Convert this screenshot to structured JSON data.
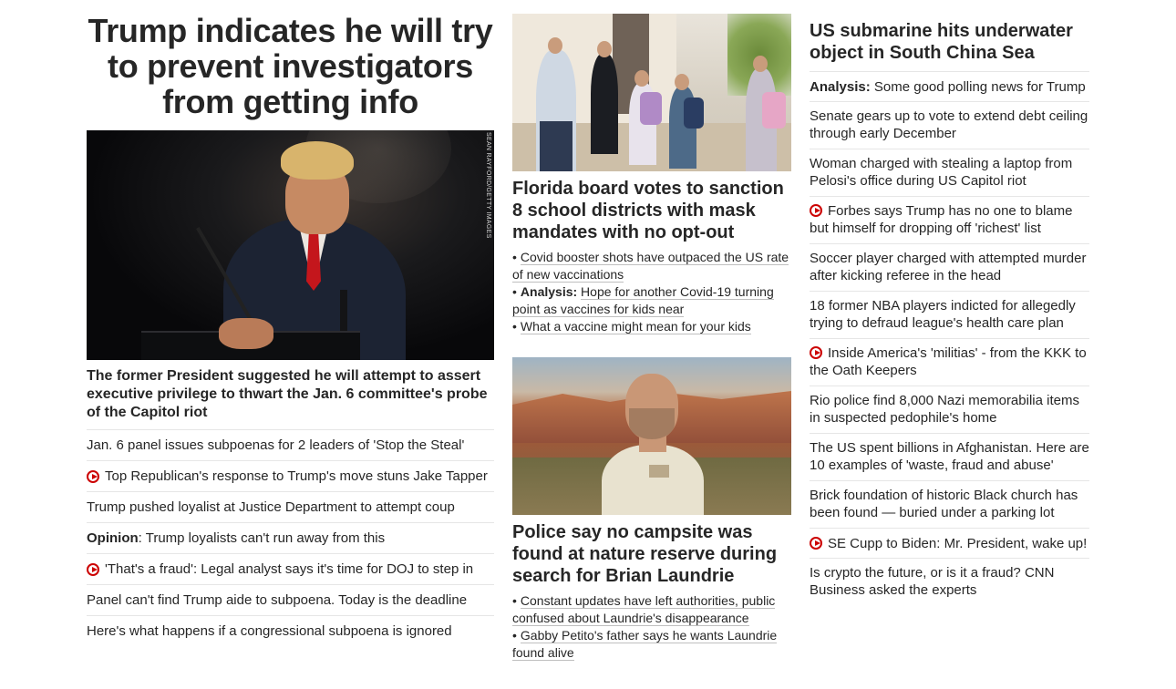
{
  "col1": {
    "headline": "Trump indicates he will try to prevent investigators from getting info",
    "photo_credit": "SEAN RAYFORD/GETTY IMAGES",
    "summary": "The former President suggested he will attempt to assert executive privilege to thwart the Jan. 6 committee's probe of the Capitol riot",
    "items": [
      {
        "prefix": "",
        "text": "Jan. 6 panel issues subpoenas for 2 leaders of 'Stop the Steal'",
        "video": false
      },
      {
        "prefix": "",
        "text": "Top Republican's response to Trump's move stuns Jake Tapper",
        "video": true
      },
      {
        "prefix": "",
        "text": "Trump pushed loyalist at Justice Department to attempt coup",
        "video": false
      },
      {
        "prefix": "Opinion",
        "text": ": Trump loyalists can't run away from this",
        "video": false
      },
      {
        "prefix": "",
        "text": "'That's a fraud': Legal analyst says it's time for DOJ to step in",
        "video": true
      },
      {
        "prefix": "",
        "text": "Panel can't find Trump aide to subpoena. Today is the deadline",
        "video": false
      },
      {
        "prefix": "",
        "text": "Here's what happens if a congressional subpoena is ignored",
        "video": false
      }
    ]
  },
  "col2": {
    "story1": {
      "headline": "Florida board votes to sanction 8 school districts with mask mandates with no opt-out",
      "bullets": [
        {
          "prefix": "",
          "text": "Covid booster shots have outpaced the US rate of new vaccinations"
        },
        {
          "prefix": "Analysis:",
          "text": "Hope for another Covid-19 turning point as vaccines for kids near"
        },
        {
          "prefix": "",
          "text": "What a vaccine might mean for your kids"
        }
      ]
    },
    "story2": {
      "headline": "Police say no campsite was found at nature reserve during search for Brian Laundrie",
      "bullets": [
        {
          "prefix": "",
          "text": "Constant updates have left authorities, public confused about Laundrie's disappearance"
        },
        {
          "prefix": "",
          "text": "Gabby Petito's father says he wants Laundrie found alive"
        }
      ]
    }
  },
  "col3": {
    "headline": "US submarine hits underwater object in South China Sea",
    "items": [
      {
        "prefix": "Analysis:",
        "text": " Some good polling news for Trump",
        "video": false
      },
      {
        "prefix": "",
        "text": "Senate gears up to vote to extend debt ceiling through early December",
        "video": false
      },
      {
        "prefix": "",
        "text": "Woman charged with stealing a laptop from Pelosi's office during US Capitol riot",
        "video": false
      },
      {
        "prefix": "",
        "text": "Forbes says Trump has no one to blame but himself for dropping off 'richest' list",
        "video": true
      },
      {
        "prefix": "",
        "text": "Soccer player charged with attempted murder after kicking referee in the head",
        "video": false
      },
      {
        "prefix": "",
        "text": "18 former NBA players indicted for allegedly trying to defraud league's health care plan",
        "video": false
      },
      {
        "prefix": "",
        "text": "Inside America's 'militias' - from the KKK to the Oath Keepers",
        "video": true
      },
      {
        "prefix": "",
        "text": "Rio police find 8,000 Nazi memorabilia items in suspected pedophile's home",
        "video": false
      },
      {
        "prefix": "",
        "text": "The US spent billions in Afghanistan. Here are 10 examples of 'waste, fraud and abuse'",
        "video": false
      },
      {
        "prefix": "",
        "text": "Brick foundation of historic Black church has been found — buried under a parking lot",
        "video": false
      },
      {
        "prefix": "",
        "text": "SE Cupp to Biden: Mr. President, wake up!",
        "video": true
      },
      {
        "prefix": "",
        "text": "Is crypto the future, or is it a fraud? CNN Business asked the experts",
        "video": false
      }
    ]
  },
  "colors": {
    "video_icon": "#cc0000",
    "divider": "#e6e6e6",
    "text": "#262626"
  }
}
